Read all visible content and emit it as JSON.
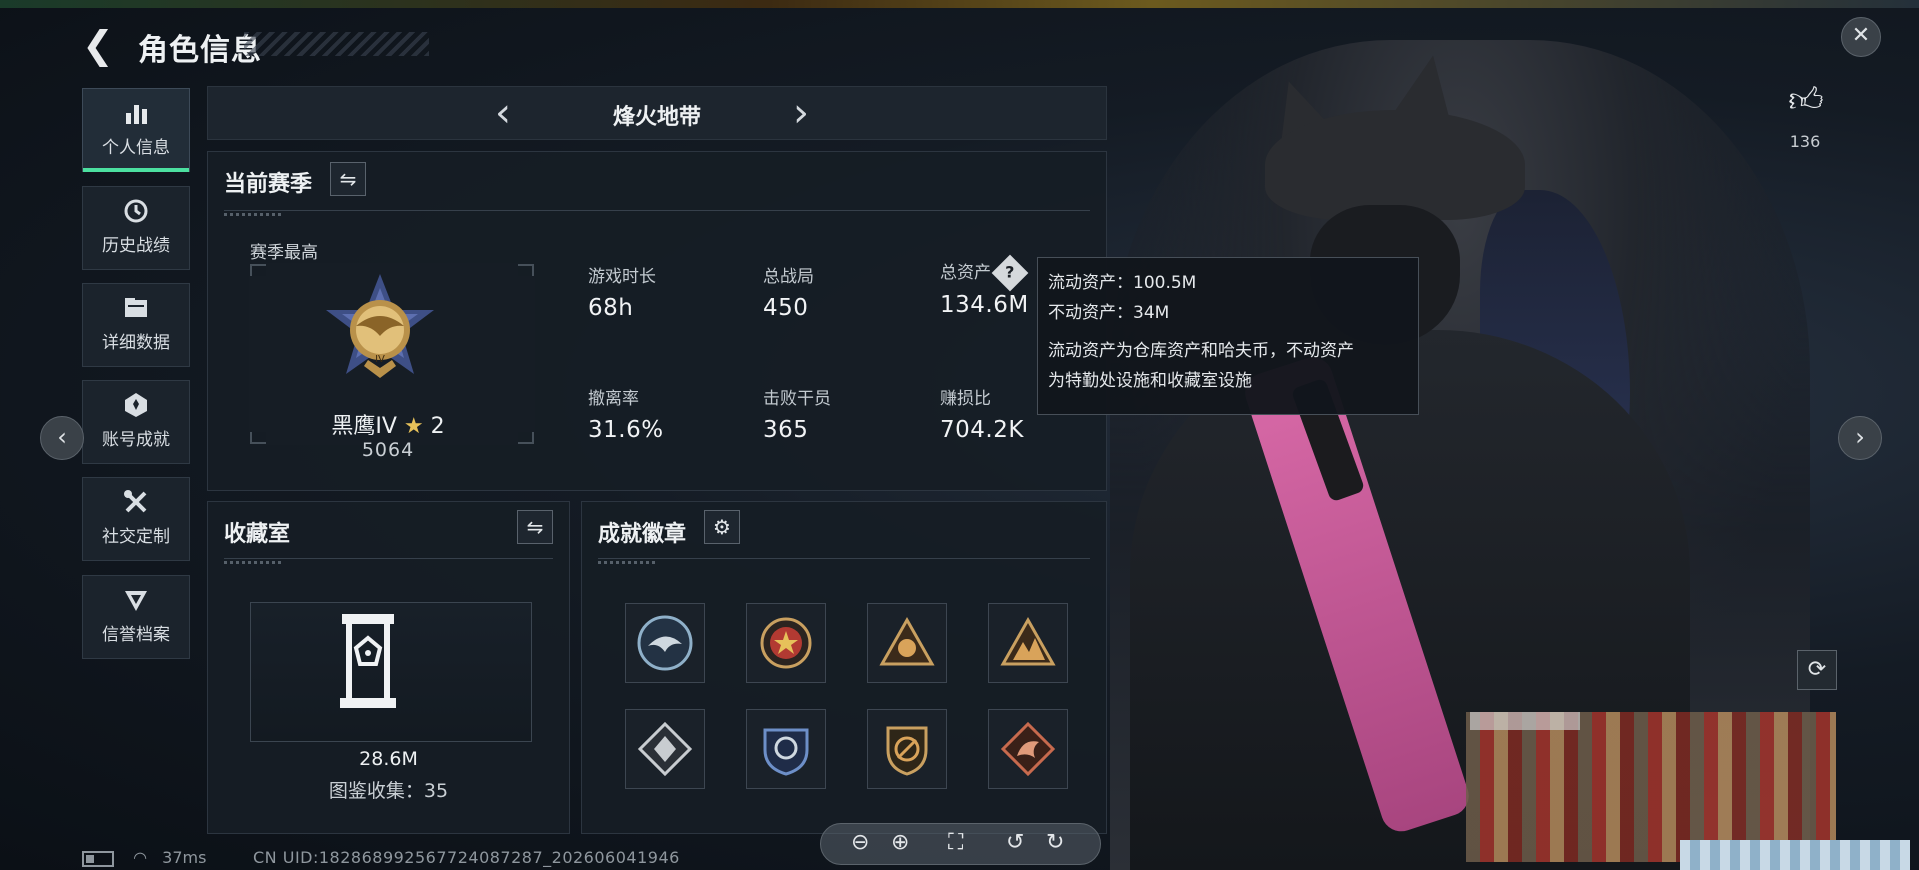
{
  "header": {
    "title": "角色信息"
  },
  "sidebar": {
    "items": [
      {
        "label": "个人信息",
        "icon": "bar-chart-icon",
        "glyph": "▮▮",
        "active": true
      },
      {
        "label": "历史战绩",
        "icon": "history-icon",
        "glyph": "◷"
      },
      {
        "label": "详细数据",
        "icon": "folder-icon",
        "glyph": "▤"
      },
      {
        "label": "账号成就",
        "icon": "achievement-icon",
        "glyph": "✪"
      },
      {
        "label": "社交定制",
        "icon": "tools-icon",
        "glyph": "✕"
      },
      {
        "label": "信誉档案",
        "icon": "credit-icon",
        "glyph": "▼"
      }
    ]
  },
  "mode_tab": {
    "title": "烽火地带",
    "prev_icon": "chevron-left-icon",
    "next_icon": "chevron-right-icon"
  },
  "season": {
    "title": "当前赛季",
    "best_label": "赛季最高",
    "rank_name": "黑鹰IV",
    "rank_star": "★",
    "rank_stars": "2",
    "rank_score": "5064",
    "stats": [
      {
        "label": "游戏时长",
        "value": "68h"
      },
      {
        "label": "总战局",
        "value": "450"
      },
      {
        "label": "总资产",
        "value": "134.6M",
        "help": "?"
      },
      {
        "label": "撤离率",
        "value": "31.6%"
      },
      {
        "label": "击败干员",
        "value": "365"
      },
      {
        "label": "赚损比",
        "value": "704.2K"
      }
    ]
  },
  "tooltip": {
    "liquid": "流动资产：100.5M",
    "fixed": "不动资产：34M",
    "desc_line1": "流动资产为仓库资产和哈夫币，不动资产",
    "desc_line2": "为特勤处设施和收藏室设施"
  },
  "collection": {
    "title": "收藏室",
    "value": "28.6M",
    "collected": "图鉴收集：35"
  },
  "badges": {
    "title": "成就徽章",
    "settings_icon": "gear-icon",
    "items": [
      {
        "name": "eagle-badge",
        "color": "#8fb0c9"
      },
      {
        "name": "star-wing-badge",
        "color": "#c0443a"
      },
      {
        "name": "triangle-badge",
        "color": "#c9a060"
      },
      {
        "name": "mountain-badge",
        "color": "#c9a060"
      },
      {
        "name": "diamond-badge",
        "color": "#c8ccd0"
      },
      {
        "name": "shield-badge",
        "color": "#6d8fc8"
      },
      {
        "name": "round-shield-badge",
        "color": "#c9a060"
      },
      {
        "name": "dragon-badge",
        "color": "#c76a4e"
      }
    ]
  },
  "like": {
    "count": "136"
  },
  "toolbar": {
    "zoom_out": "⊖",
    "zoom_in": "⊕",
    "fit": "⛶",
    "rotate_left": "↺",
    "rotate_right": "↻"
  },
  "status": {
    "ping": "37ms",
    "uid": "CN UID:18286899256772408728​7_202606041946"
  },
  "colors": {
    "accent": "#4ce0a0",
    "gold": "#e6c15a",
    "panel": "#161d25"
  }
}
